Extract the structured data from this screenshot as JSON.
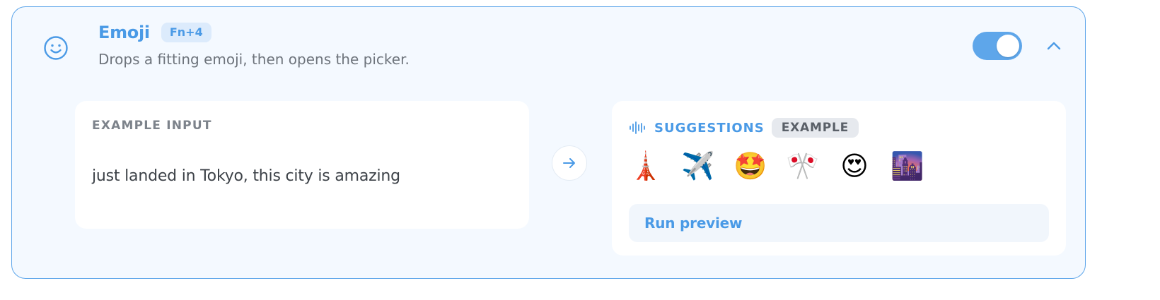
{
  "feature": {
    "title": "Emoji",
    "shortcut": "Fn+4",
    "description": "Drops a fitting emoji, then opens the picker.",
    "enabled": true,
    "icon": "smile-icon"
  },
  "example_input": {
    "label": "EXAMPLE INPUT",
    "text": "just landed in Tokyo, this city is amazing"
  },
  "suggestions": {
    "label": "SUGGESTIONS",
    "badge": "EXAMPLE",
    "emojis": [
      "🗼",
      "✈️",
      "🤩",
      "🎌",
      "😍",
      "🌆"
    ],
    "run_label": "Run preview"
  },
  "colors": {
    "accent": "#4a9ae6",
    "border": "#5ea6ea",
    "card_bg": "#f4f9ff"
  }
}
